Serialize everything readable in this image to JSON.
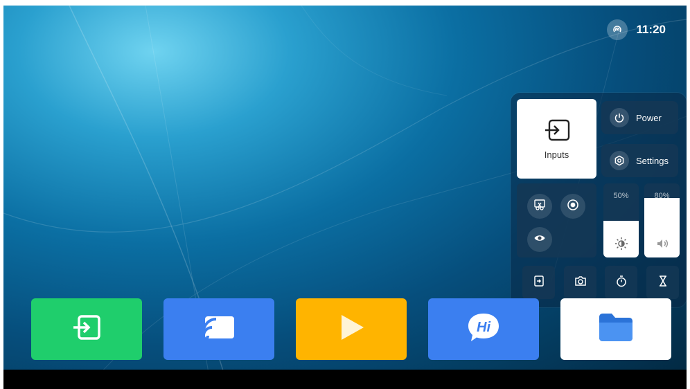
{
  "status_bar": {
    "time": "11:20",
    "hotspot_icon": "hotspot-icon"
  },
  "quick_panel": {
    "inputs": {
      "label": "Inputs",
      "icon": "input-source-icon"
    },
    "power": {
      "label": "Power",
      "icon": "power-icon"
    },
    "settings": {
      "label": "Settings",
      "icon": "gear-icon"
    },
    "mini_buttons": [
      {
        "name": "screenshot-crop",
        "icon": "scissors-icon"
      },
      {
        "name": "screen-record",
        "icon": "record-icon"
      },
      {
        "name": "eye-care",
        "icon": "eye-icon"
      }
    ],
    "brightness": {
      "label": "50%",
      "level": 0.5,
      "icon": "brightness-icon"
    },
    "volume": {
      "label": "80%",
      "level": 0.8,
      "icon": "volume-icon"
    },
    "tools": [
      {
        "name": "signal-source",
        "icon": "source-switch-icon"
      },
      {
        "name": "camera",
        "icon": "camera-icon"
      },
      {
        "name": "timer",
        "icon": "stopwatch-icon"
      },
      {
        "name": "sleep-timer",
        "icon": "hourglass-icon"
      }
    ]
  },
  "dock": [
    {
      "name": "input-app",
      "icon": "input-source-icon",
      "color": "#1fce6c"
    },
    {
      "name": "screen-cast",
      "icon": "cast-icon",
      "color": "#3b7ff0"
    },
    {
      "name": "media-player",
      "icon": "play-icon",
      "color": "#ffb400"
    },
    {
      "name": "hi-assistant",
      "icon": "hi-bubble-icon",
      "color": "#3b7ff0"
    },
    {
      "name": "file-manager",
      "icon": "folder-icon",
      "color": "#ffffff"
    }
  ]
}
